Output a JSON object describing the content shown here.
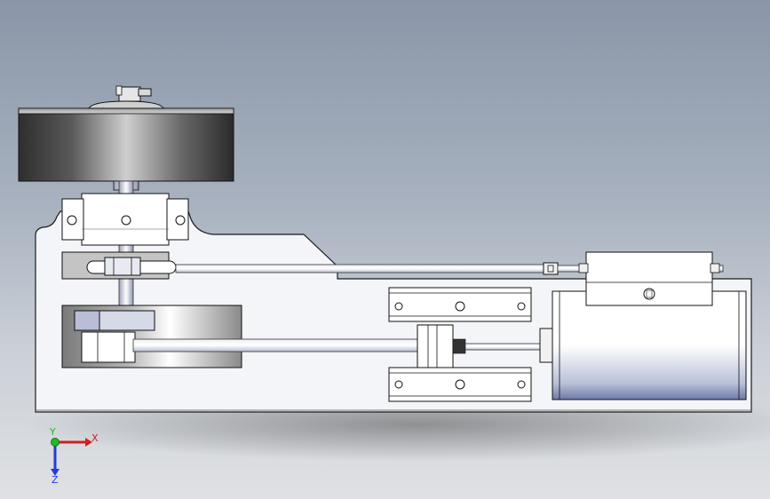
{
  "viewport": {
    "background_top": "#8a96a8",
    "background_bottom": "#dfe1e4"
  },
  "model": {
    "parts": [
      "flywheel",
      "bearing-block",
      "crank-pulley",
      "crank-disc",
      "crosshead-guide",
      "connecting-rod",
      "piston-rod",
      "cylinder",
      "valve-chest",
      "base-frame"
    ],
    "colors": {
      "body_fill": "#f4f5f8",
      "edge": "#1a1a1a",
      "flywheel_dark": "#3a3a3a",
      "flywheel_light": "#c8c8c8"
    }
  },
  "triad": {
    "x_label": "X",
    "y_label": "Y",
    "z_label": "Z",
    "x_color": "#d21f1f",
    "y_color": "#22b82a",
    "z_color": "#1f3fd2"
  }
}
